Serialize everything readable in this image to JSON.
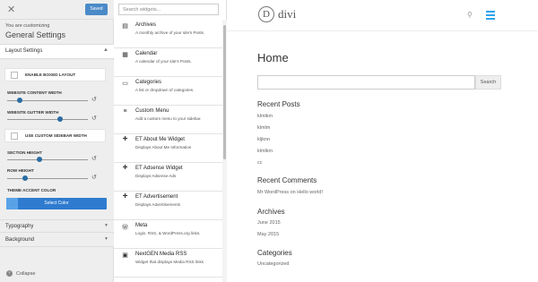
{
  "customizer": {
    "close_icon": "close-icon",
    "saved_label": "Saved",
    "subtitle": "You are customizing",
    "title": "General Settings",
    "layout_section": {
      "label": "Layout Settings",
      "arrow": "▲",
      "boxed_layout_label": "ENABLE BOXED LAYOUT",
      "content_width_label": "WEBSITE CONTENT WIDTH",
      "content_width_level": 0.15,
      "gutter_width_label": "WEBSITE GUTTER WIDTH",
      "gutter_width_level": 0.66,
      "custom_sidebar_label": "USE CUSTOM SIDEBAR WIDTH",
      "section_height_label": "SECTION HEIGHT",
      "section_height_level": 0.4,
      "row_height_label": "ROW HEIGHT",
      "row_height_level": 0.22,
      "accent_color_label": "THEME ACCENT COLOR",
      "select_color_label": "Select Color",
      "accent_color": "#2e7bcf"
    },
    "typography_label": "Typography",
    "background_label": "Background",
    "section_arrow": "▼",
    "collapse_label": "Collapse"
  },
  "widgets": {
    "search_placeholder": "Search widgets...",
    "items": [
      {
        "title": "Archives",
        "desc": "A monthly archive of your site's Posts.",
        "icon": "archive-icon",
        "glyph": "▤"
      },
      {
        "title": "Calendar",
        "desc": "A calendar of your site's Posts.",
        "icon": "calendar-icon",
        "glyph": "▦"
      },
      {
        "title": "Categories",
        "desc": "A list or dropdown of categories.",
        "icon": "folder-icon",
        "glyph": "▭"
      },
      {
        "title": "Custom Menu",
        "desc": "Add a custom menu to your sidebar.",
        "icon": "menu-icon",
        "glyph": "≡"
      },
      {
        "title": "ET About Me Widget",
        "desc": "Displays About Me Information",
        "icon": "plus-icon",
        "glyph": "+"
      },
      {
        "title": "ET Adsense Widget",
        "desc": "Displays Adsense Ads",
        "icon": "plus-icon",
        "glyph": "+"
      },
      {
        "title": "ET Advertisement",
        "desc": "Displays Advertisements",
        "icon": "plus-icon",
        "glyph": "+"
      },
      {
        "title": "Meta",
        "desc": "Login, RSS, & WordPress.org links.",
        "icon": "wordpress-icon",
        "glyph": "Ⓦ"
      },
      {
        "title": "NextGEN Media RSS",
        "desc": "Widget that displays Media RSS links",
        "icon": "image-icon",
        "glyph": "▣"
      }
    ]
  },
  "preview": {
    "logo_letter": "D",
    "logo_text": "divi",
    "accent_color": "#2ea3f2",
    "page_title": "Home",
    "search_button": "Search",
    "recent_posts": {
      "heading": "Recent Posts",
      "items": [
        "klmlkm",
        "klmlm",
        "kljknn",
        "klmlkm",
        "cc"
      ]
    },
    "recent_comments": {
      "heading": "Recent Comments",
      "author": "Mr WordPress",
      "on": " on ",
      "post": "Hello world!"
    },
    "archives": {
      "heading": "Archives",
      "items": [
        "June 2015",
        "May 2015"
      ]
    },
    "categories": {
      "heading": "Categories",
      "items": [
        "Uncategorized"
      ]
    }
  }
}
